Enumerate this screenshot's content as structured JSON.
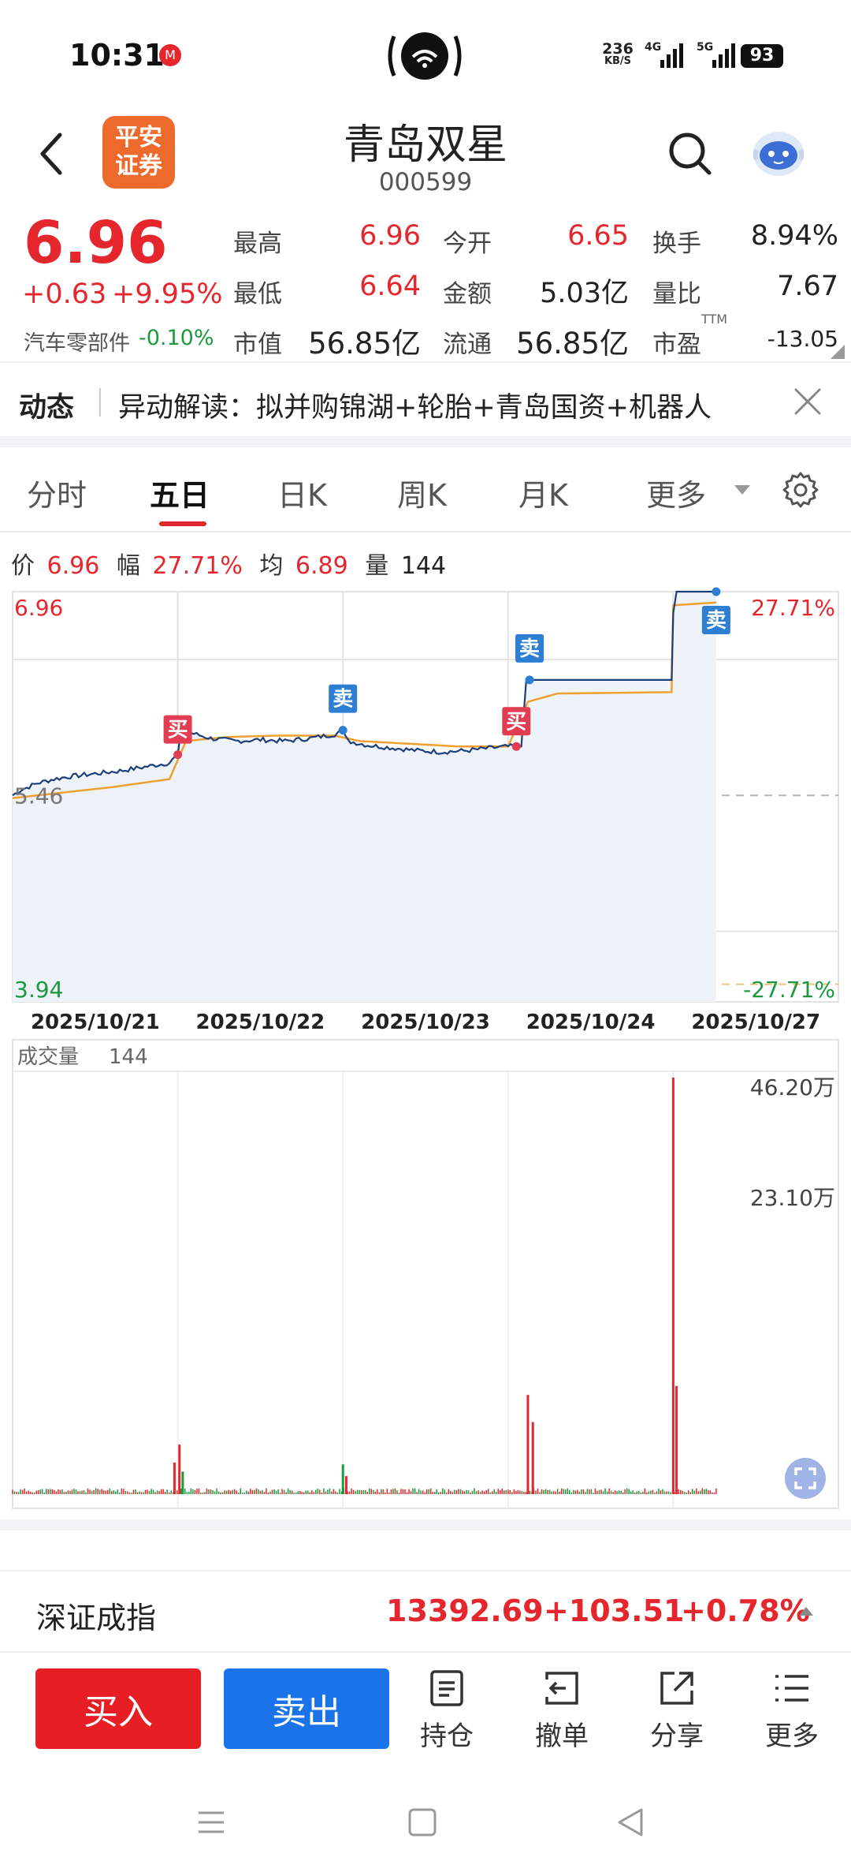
{
  "status": {
    "time": "10:31",
    "speed_top": "236",
    "speed_bottom": "KB/S",
    "net1": "4G",
    "net2": "5G",
    "battery": "93"
  },
  "header": {
    "logo_line1": "平安",
    "logo_line2": "证券",
    "title": "青岛双星",
    "code": "000599"
  },
  "quote": {
    "price": "6.96",
    "change": "+0.63",
    "change_pct": "+9.95%",
    "sector_label": "汽车零部件",
    "sector_change": "-0.10%",
    "fields": [
      {
        "label": "最高",
        "value": "6.96",
        "color": "red"
      },
      {
        "label": "今开",
        "value": "6.65",
        "color": "red"
      },
      {
        "label": "换手",
        "value": "8.94%",
        "color": "black"
      },
      {
        "label": "最低",
        "value": "6.64",
        "color": "red"
      },
      {
        "label": "金额",
        "value": "5.03亿",
        "color": "black"
      },
      {
        "label": "量比",
        "value": "7.67",
        "color": "black"
      },
      {
        "label": "市值",
        "value": "56.85亿",
        "color": "black"
      },
      {
        "label": "流通",
        "value": "56.85亿",
        "color": "black"
      },
      {
        "label": "市盈",
        "value": "-13.05",
        "color": "black"
      }
    ],
    "ttm": "TTM"
  },
  "news": {
    "tag": "动态",
    "text": "异动解读：拟并购锦湖+轮胎+青岛国资+机器人"
  },
  "tabs": [
    "分时",
    "五日",
    "日K",
    "周K",
    "月K",
    "更多"
  ],
  "active_tab": 1,
  "info": {
    "price_label": "价",
    "price": "6.96",
    "amp_label": "幅",
    "amp": "27.71%",
    "avg_label": "均",
    "avg": "6.89",
    "vol_label": "量",
    "vol": "144"
  },
  "chart_data": {
    "type": "line",
    "y_top_label": "6.96",
    "y_mid_label": "5.46",
    "y_bottom_label": "3.94",
    "pct_top_label": "27.71%",
    "pct_bottom_label": "-27.71%",
    "ylim": [
      3.94,
      6.96
    ],
    "prev_close": 5.46,
    "x_dates": [
      "2025/10/21",
      "2025/10/22",
      "2025/10/23",
      "2025/10/24",
      "2025/10/27"
    ],
    "price_series": [
      {
        "t": 0.0,
        "v": 5.46
      },
      {
        "t": 0.05,
        "v": 5.5
      },
      {
        "t": 0.15,
        "v": 5.55
      },
      {
        "t": 0.25,
        "v": 5.58
      },
      {
        "t": 0.35,
        "v": 5.6
      },
      {
        "t": 0.5,
        "v": 5.62
      },
      {
        "t": 0.65,
        "v": 5.64
      },
      {
        "t": 0.8,
        "v": 5.67
      },
      {
        "t": 0.95,
        "v": 5.7
      },
      {
        "t": 1.0,
        "v": 5.76
      },
      {
        "t": 1.03,
        "v": 6.03
      },
      {
        "t": 1.08,
        "v": 5.92
      },
      {
        "t": 1.2,
        "v": 5.88
      },
      {
        "t": 1.35,
        "v": 5.86
      },
      {
        "t": 1.5,
        "v": 5.87
      },
      {
        "t": 1.65,
        "v": 5.86
      },
      {
        "t": 1.8,
        "v": 5.88
      },
      {
        "t": 1.95,
        "v": 5.91
      },
      {
        "t": 2.0,
        "v": 5.94
      },
      {
        "t": 2.03,
        "v": 5.86
      },
      {
        "t": 2.15,
        "v": 5.83
      },
      {
        "t": 2.3,
        "v": 5.81
      },
      {
        "t": 2.45,
        "v": 5.79
      },
      {
        "t": 2.6,
        "v": 5.78
      },
      {
        "t": 2.75,
        "v": 5.79
      },
      {
        "t": 2.9,
        "v": 5.81
      },
      {
        "t": 3.0,
        "v": 5.82
      },
      {
        "t": 3.08,
        "v": 5.82
      },
      {
        "t": 3.11,
        "v": 6.31
      },
      {
        "t": 3.5,
        "v": 6.31
      },
      {
        "t": 3.99,
        "v": 6.31
      },
      {
        "t": 4.0,
        "v": 6.8
      },
      {
        "t": 4.02,
        "v": 6.96
      },
      {
        "t": 4.26,
        "v": 6.96
      }
    ],
    "avg_series": [
      {
        "t": 0.0,
        "v": 5.44
      },
      {
        "t": 0.3,
        "v": 5.48
      },
      {
        "t": 0.6,
        "v": 5.52
      },
      {
        "t": 0.95,
        "v": 5.58
      },
      {
        "t": 1.05,
        "v": 5.86
      },
      {
        "t": 1.3,
        "v": 5.89
      },
      {
        "t": 1.6,
        "v": 5.9
      },
      {
        "t": 1.95,
        "v": 5.9
      },
      {
        "t": 2.1,
        "v": 5.86
      },
      {
        "t": 2.4,
        "v": 5.84
      },
      {
        "t": 2.7,
        "v": 5.82
      },
      {
        "t": 3.0,
        "v": 5.82
      },
      {
        "t": 3.12,
        "v": 6.15
      },
      {
        "t": 3.3,
        "v": 6.21
      },
      {
        "t": 3.99,
        "v": 6.22
      },
      {
        "t": 4.0,
        "v": 6.86
      },
      {
        "t": 4.26,
        "v": 6.88
      }
    ],
    "signals": [
      {
        "t": 1.0,
        "v": 5.76,
        "type": "buy",
        "label": "买"
      },
      {
        "t": 2.0,
        "v": 5.94,
        "type": "sell",
        "label": "卖"
      },
      {
        "t": 3.05,
        "v": 5.82,
        "type": "buy",
        "label": "买"
      },
      {
        "t": 3.13,
        "v": 6.31,
        "type": "sell",
        "label": "卖"
      },
      {
        "t": 4.26,
        "v": 6.96,
        "type": "sell",
        "label": "卖"
      }
    ],
    "volume_label": "成交量",
    "volume_value": "144",
    "volume_top_label": "46.20万",
    "volume_mid_label": "23.10万",
    "volume_max": 46.2,
    "volume_spikes": [
      {
        "t": 0.98,
        "v": 3.5,
        "c": "red"
      },
      {
        "t": 1.01,
        "v": 5.5,
        "c": "red"
      },
      {
        "t": 1.03,
        "v": 2.5,
        "c": "green"
      },
      {
        "t": 2.0,
        "v": 3.3,
        "c": "green"
      },
      {
        "t": 2.02,
        "v": 2.0,
        "c": "red"
      },
      {
        "t": 3.12,
        "v": 11.0,
        "c": "red"
      },
      {
        "t": 3.15,
        "v": 8.0,
        "c": "red"
      },
      {
        "t": 4.0,
        "v": 46.2,
        "c": "red"
      },
      {
        "t": 4.02,
        "v": 12.0,
        "c": "red"
      }
    ]
  },
  "index_bar": {
    "name": "深证成指",
    "value": "13392.69",
    "change": "+103.51",
    "pct": "+0.78%"
  },
  "actions": {
    "buy": "买入",
    "sell": "卖出",
    "items": [
      "持仓",
      "撤单",
      "分享",
      "更多"
    ]
  },
  "colors": {
    "red": "#e5262c",
    "green": "#1a9a3c",
    "blue_line": "#1c3f7a",
    "avg_line": "#f0a030",
    "sell_badge": "#2d7fd3",
    "buy_badge": "#e23d53"
  }
}
